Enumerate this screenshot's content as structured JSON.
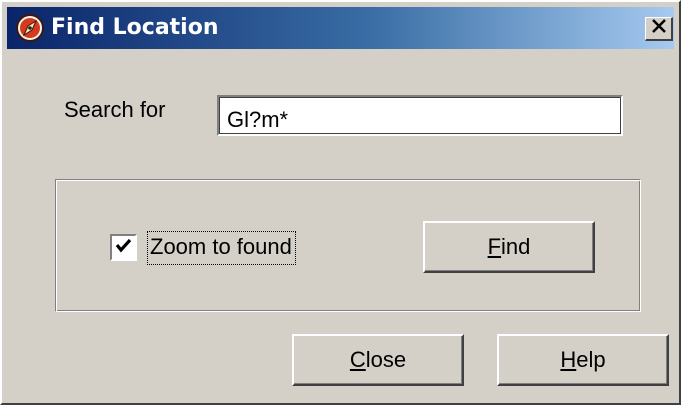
{
  "window": {
    "title": "Find Location",
    "close_glyph": "×",
    "app_icon": "compass-icon"
  },
  "search": {
    "label": "Search for",
    "value": "Gl?m*"
  },
  "options": {
    "zoom_label": "Zoom to found",
    "zoom_checked": true
  },
  "buttons": {
    "find": {
      "accel": "F",
      "rest": "ind"
    },
    "close": {
      "accel": "C",
      "rest": "lose"
    },
    "help": {
      "accel": "H",
      "rest": "elp"
    }
  },
  "colors": {
    "face": "#d4d0c8",
    "title_start": "#0a246a",
    "title_end": "#a6caf0",
    "icon_accent": "#d63a1e"
  }
}
